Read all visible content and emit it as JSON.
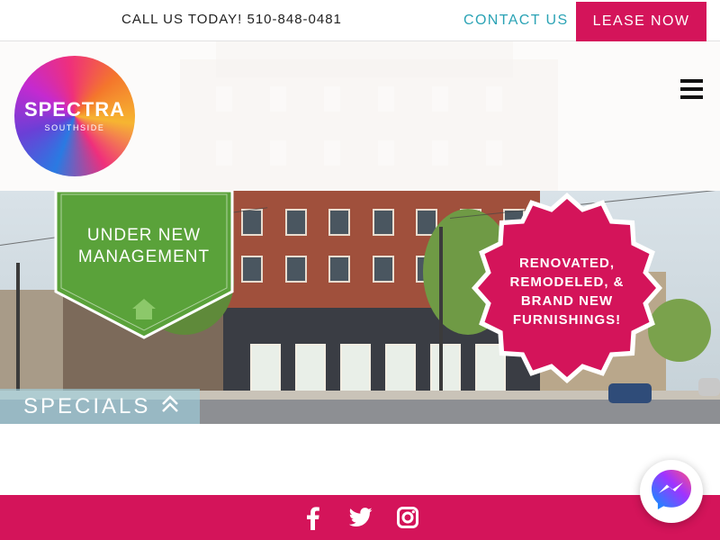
{
  "topbar": {
    "phone_text": "CALL US TODAY! 510-848-0481",
    "contact_label": "CONTACT US",
    "lease_label": "LEASE NOW"
  },
  "logo": {
    "brand": "SPECTRA",
    "sub": "SOUTHSIDE"
  },
  "hero": {
    "badge_lines": [
      "UNDER NEW",
      "MANAGEMENT"
    ],
    "burst_lines": [
      "RENOVATED,",
      "REMODELED, &",
      "BRAND NEW",
      "FURNISHINGS!"
    ],
    "specials_label": "SPECIALS"
  },
  "footer": {
    "social_icons": [
      "facebook-icon",
      "twitter-icon",
      "instagram-icon"
    ]
  },
  "colors": {
    "brand_pink": "#d4145a",
    "accent_teal": "#2ba3b5",
    "badge_green": "#5aa23a"
  }
}
